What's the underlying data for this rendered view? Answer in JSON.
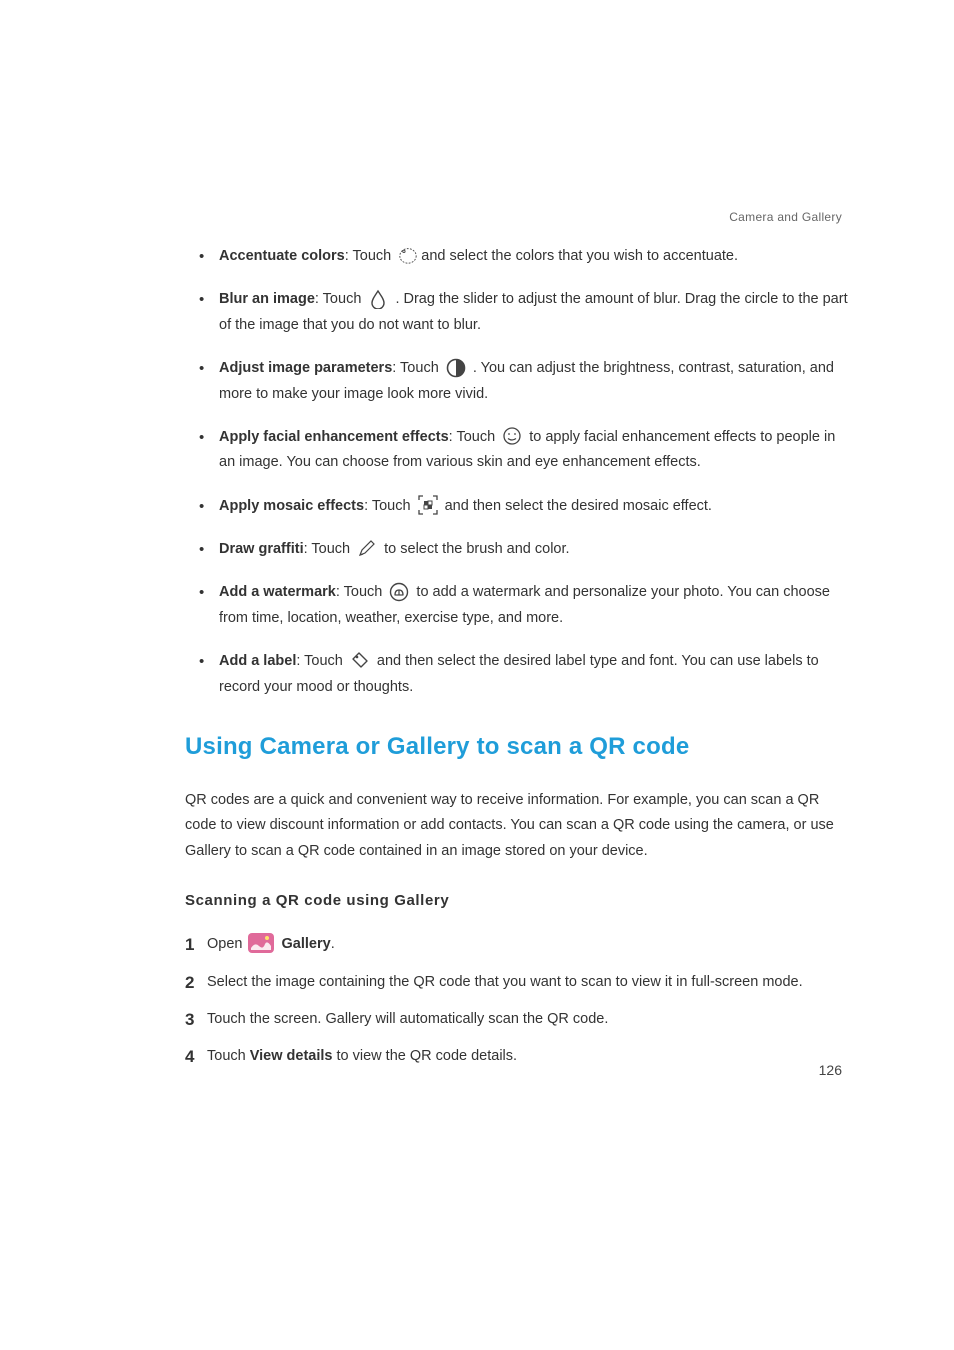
{
  "header": {
    "section": "Camera and Gallery"
  },
  "page_number": "126",
  "items": {
    "accentuate": {
      "title": "Accentuate colors",
      "pre": ": Touch ",
      "post": "and select the colors that you wish to accentuate."
    },
    "blur": {
      "title": "Blur an image",
      "pre": ": Touch ",
      "post": " . Drag the slider to adjust the amount of blur. Drag the circle to the part of the image that you do not want to blur."
    },
    "adjust": {
      "title": "Adjust image parameters",
      "pre": ": Touch ",
      "post": " . You can adjust the brightness, contrast, saturation, and more to make your image look more vivid."
    },
    "facial": {
      "title": "Apply facial enhancement effects",
      "pre": ": Touch ",
      "post": " to apply facial enhancement effects to people in an image. You can choose from various skin and eye enhancement effects."
    },
    "mosaic": {
      "title": "Apply mosaic effects",
      "pre": ": Touch ",
      "post": " and then select the desired mosaic effect."
    },
    "graffiti": {
      "title": "Draw graffiti",
      "pre": ": Touch ",
      "post": " to select the brush and color."
    },
    "watermark": {
      "title": "Add a watermark",
      "pre": ": Touch ",
      "post": " to add a watermark and personalize your photo. You can choose from time, location, weather, exercise type, and more."
    },
    "label": {
      "title": "Add a label",
      "pre": ": Touch ",
      "post": " and then select the desired label type and font. You can use labels to record your mood or thoughts."
    }
  },
  "section": {
    "title": "Using Camera or Gallery to scan a QR code",
    "intro": "QR codes are a quick and convenient way to receive information. For example, you can scan a QR code to view discount information or add contacts. You can scan a QR code using the camera, or use Gallery to scan a QR code contained in an image stored on your device.",
    "subhead": "Scanning a QR code using Gallery",
    "steps": {
      "s1_pre": "Open ",
      "s1_app": "Gallery",
      "s1_post": ".",
      "s2": "Select the image containing the QR code that you want to scan to view it in full-screen mode.",
      "s3": "Touch the screen. Gallery will automatically scan the QR code.",
      "s4_pre": "Touch ",
      "s4_bold": "View details",
      "s4_post": " to view the QR code details."
    }
  }
}
